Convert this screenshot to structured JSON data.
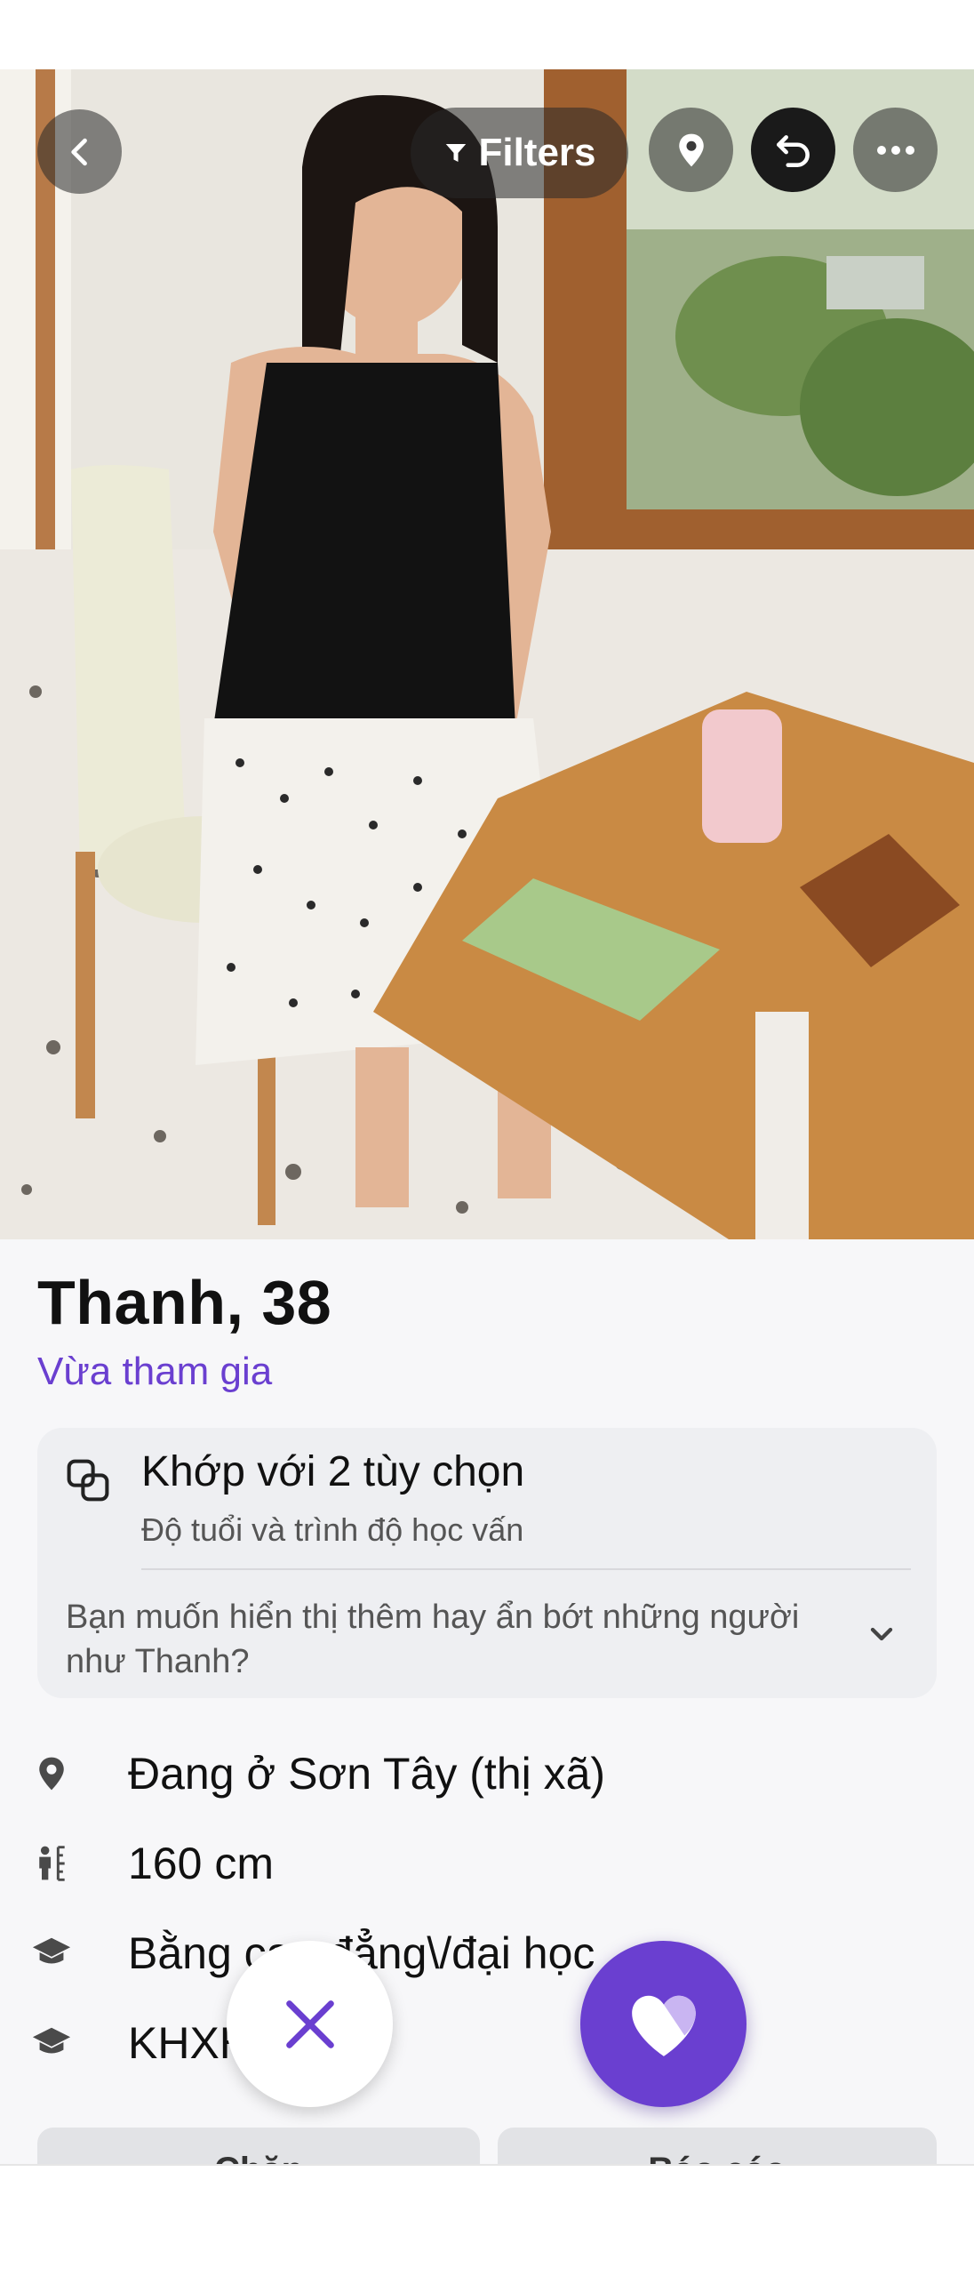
{
  "toolbar": {
    "back_icon": "chevron-left-icon",
    "filters_label": "Filters",
    "filters_icon": "filter-icon",
    "location_icon": "map-pin-icon",
    "undo_icon": "undo-icon",
    "more_icon": "more-horizontal-icon"
  },
  "profile": {
    "name_age": "Thanh, 38",
    "status": "Vừa tham gia"
  },
  "match": {
    "icon": "overlap-squares-icon",
    "title": "Khớp với 2 tùy chọn",
    "subtitle": "Độ tuổi và trình độ học vấn",
    "question": "Bạn muốn hiển thị thêm hay ẩn bớt những người như Thanh?",
    "chevron": "chevron-down-icon"
  },
  "details": [
    {
      "icon": "map-pin-icon",
      "text": "Đang ở Sơn Tây (thị xã)"
    },
    {
      "icon": "height-icon",
      "text": "160 cm"
    },
    {
      "icon": "graduation-cap-icon",
      "text": "Bằng cao đẳng\\/đại học"
    },
    {
      "icon": "graduation-cap-icon",
      "text": "KHXH"
    }
  ],
  "actions": {
    "pass_icon": "close-icon",
    "like_icon": "heart-icon"
  },
  "bottom": {
    "block_label": "Chặn",
    "report_label": "Báo cáo"
  },
  "colors": {
    "accent": "#6a3fd0",
    "background": "#f7f7f9",
    "card": "#eeeff2"
  }
}
